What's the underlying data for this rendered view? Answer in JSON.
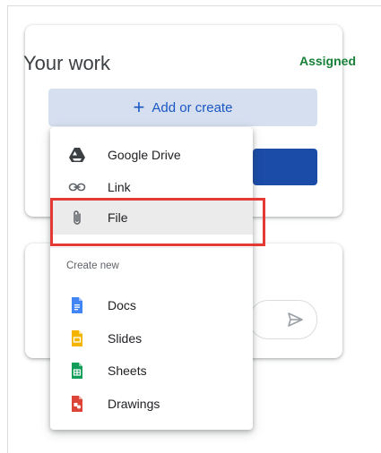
{
  "work": {
    "title": "Your work",
    "status": "Assigned",
    "add_label": "Add or create"
  },
  "menu": {
    "items": [
      {
        "label": "Google Drive",
        "icon": "google-drive-icon"
      },
      {
        "label": "Link",
        "icon": "link-icon"
      },
      {
        "label": "File",
        "icon": "attachment-icon"
      }
    ],
    "create_heading": "Create new",
    "create_items": [
      {
        "label": "Docs",
        "icon": "docs-icon",
        "color": "#4285f4"
      },
      {
        "label": "Slides",
        "icon": "slides-icon",
        "color": "#f4b400"
      },
      {
        "label": "Sheets",
        "icon": "sheets-icon",
        "color": "#0f9d58"
      },
      {
        "label": "Drawings",
        "icon": "drawings-icon",
        "color": "#db4437"
      }
    ]
  },
  "colors": {
    "status": "#188038",
    "add_button_bg": "#d5dff0",
    "accent": "#1a57c4",
    "highlight": "#e53935"
  }
}
